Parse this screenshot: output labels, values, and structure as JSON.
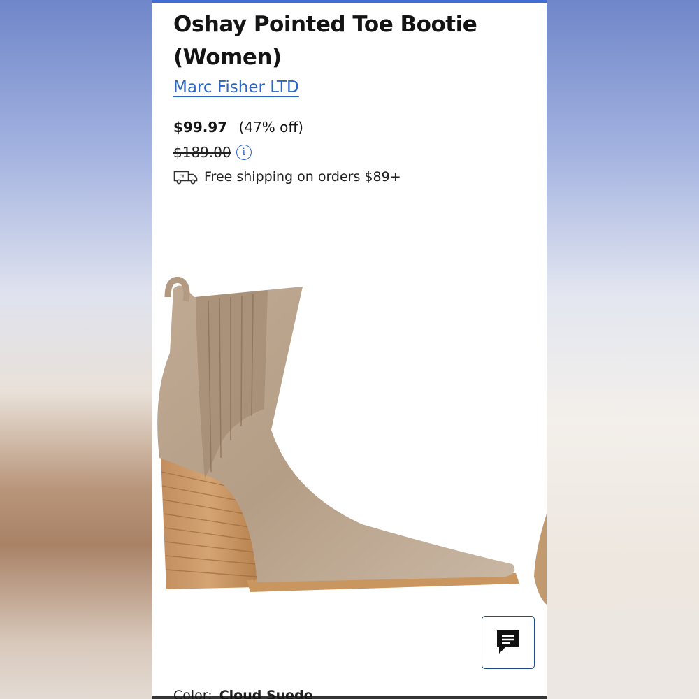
{
  "product": {
    "title": "Oshay Pointed Toe Bootie (Women)",
    "brand": "Marc Fisher LTD",
    "sale_price": "$99.97",
    "discount": "(47% off)",
    "original_price": "$189.00",
    "info_icon": "info-icon",
    "shipping_text": "Free shipping on orders $89+",
    "shipping_icon": "truck-icon"
  },
  "bottom": {
    "color_label": "Color:",
    "color_value": "Cloud Suede"
  },
  "chat": {
    "icon": "chat-icon"
  },
  "colors": {
    "accent": "#2a66c6",
    "topbar": "#3e6dd8",
    "text": "#141414"
  }
}
